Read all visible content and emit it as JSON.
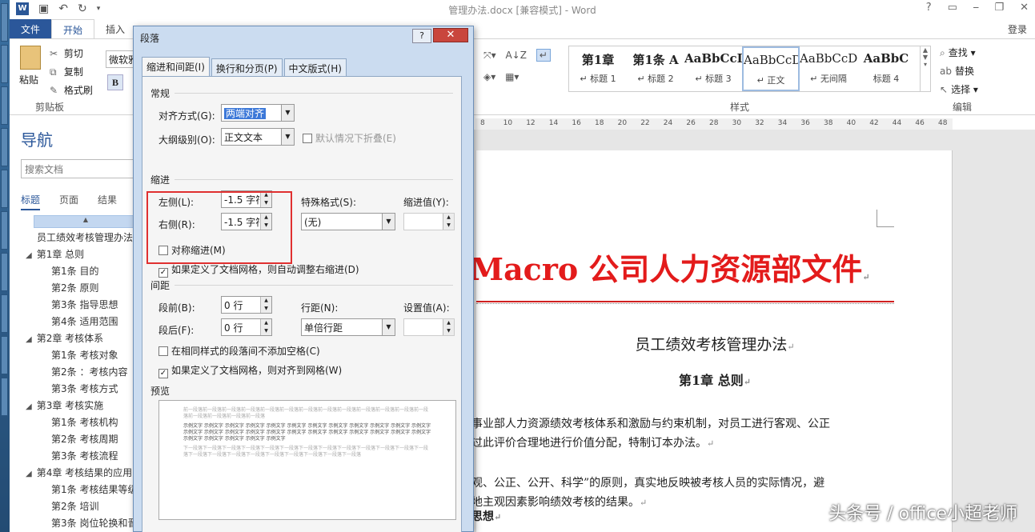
{
  "window": {
    "title": "管理办法.docx [兼容模式] - Word",
    "ctrl_help": "?",
    "ctrl_min": "⎯",
    "ctrl_restore": "❐",
    "ctrl_close": "✕"
  },
  "qat": {
    "app_icon": "W"
  },
  "ribbon": {
    "tabs": [
      "文件",
      "开始",
      "插入"
    ],
    "login": "登录",
    "clipboard": {
      "paste": "粘贴",
      "cut": "剪切",
      "copy": "复制",
      "format_painter": "格式刷",
      "group": "剪贴板"
    },
    "font_name": "微软雅",
    "bold": "B",
    "styles_group": "样式",
    "editing_group": "编辑",
    "styles": [
      {
        "sample": "第1章",
        "name": "↵ 标题 1"
      },
      {
        "sample": "第1条 A",
        "name": "↵ 标题 2"
      },
      {
        "sample": "AaBbCcI",
        "name": "↵ 标题 3"
      },
      {
        "sample": "AaBbCcDd",
        "name": "↵ 正文"
      },
      {
        "sample": "AaBbCcDd",
        "name": "↵ 无间隔"
      },
      {
        "sample": "AaBbC",
        "name": "标题 4"
      }
    ],
    "editing": {
      "find": "查找",
      "replace": "替换",
      "select": "选择"
    }
  },
  "nav": {
    "title": "导航",
    "search_placeholder": "搜索文档",
    "tabs": [
      "标题",
      "页面",
      "结果"
    ],
    "items": [
      {
        "level": 0,
        "text": "员工绩效考核管理办法"
      },
      {
        "level": 1,
        "text": "第1章 总则"
      },
      {
        "level": 2,
        "text": "第1条 目的"
      },
      {
        "level": 2,
        "text": "第2条 原则"
      },
      {
        "level": 2,
        "text": "第3条 指导思想"
      },
      {
        "level": 2,
        "text": "第4条 适用范围"
      },
      {
        "level": 1,
        "text": "第2章 考核体系"
      },
      {
        "level": 2,
        "text": "第1条 考核对象"
      },
      {
        "level": 2,
        "text": "第2条 ：考核内容"
      },
      {
        "level": 2,
        "text": "第3条 考核方式"
      },
      {
        "level": 1,
        "text": "第3章 考核实施"
      },
      {
        "level": 2,
        "text": "第1条 考核机构"
      },
      {
        "level": 2,
        "text": "第2条 考核周期"
      },
      {
        "level": 2,
        "text": "第3条 考核流程"
      },
      {
        "level": 1,
        "text": "第4章 考核结果的应用"
      },
      {
        "level": 2,
        "text": "第1条 考核结果等级"
      },
      {
        "level": 2,
        "text": "第2条 培训"
      },
      {
        "level": 2,
        "text": "第3条 岗位轮换和晋"
      }
    ]
  },
  "ruler": [
    "8",
    "10",
    "12",
    "14",
    "16",
    "18",
    "20",
    "22",
    "24",
    "26",
    "28",
    "30",
    "32",
    "34",
    "36",
    "38",
    "40",
    "42",
    "44",
    "46",
    "48"
  ],
  "document": {
    "red_title": "Macro 公司人力资源部文件",
    "title": "员工绩效考核管理办法",
    "chapter": "第1章  总则",
    "para1_line1": "事业部人力资源绩效考核体系和激励与约束机制，对员工进行客观、公正",
    "para1_line2": "过此评价合理地进行价值分配，特制订本办法。",
    "para2_line1": "观、公正、公开、科学”的原则，真实地反映被考核人员的实际情况，避",
    "para2_line2": "地主观因素影响绩效考核的结果。",
    "para3": "思想"
  },
  "dialog": {
    "title": "段落",
    "help": "?",
    "close": "✕",
    "tabs": [
      "缩进和间距(I)",
      "换行和分页(P)",
      "中文版式(H)"
    ],
    "general": {
      "section": "常规",
      "alignment_label": "对齐方式(G):",
      "alignment_value": "两端对齐",
      "outline_label": "大纲级别(O):",
      "outline_value": "正文文本",
      "collapse_label": "默认情况下折叠(E)"
    },
    "indent": {
      "section": "缩进",
      "left_label": "左侧(L):",
      "left_value": "-1.5 字符",
      "right_label": "右侧(R):",
      "right_value": "-1.5 字符",
      "special_label": "特殊格式(S):",
      "special_value": "(无)",
      "by_label": "缩进值(Y):",
      "mirror_label": "对称缩进(M)",
      "auto_adjust_label": "如果定义了文档网格，则自动调整右缩进(D)"
    },
    "spacing": {
      "section": "间距",
      "before_label": "段前(B):",
      "before_value": "0 行",
      "after_label": "段后(F):",
      "after_value": "0 行",
      "line_label": "行距(N):",
      "line_value": "单倍行距",
      "at_label": "设置值(A):",
      "no_space_label": "在相同样式的段落间不添加空格(C)",
      "snap_grid_label": "如果定义了文档网格，则对齐到网格(W)"
    },
    "preview": {
      "section": "预览",
      "prev_text": "前一段落前一段落前一段落前一段落前一段落前一段落前一段落前一段落前一段落前一段落前一段落前一段落前一段落前一段落前一段落前一段落前一段落",
      "sample_text": "示例文字 示例文字 示例文字 示例文字 示例文字 示例文字 示例文字 示例文字 示例文字 示例文字 示例文字 示例文字 示例文字 示例文字 示例文字 示例文字 示例文字 示例文字 示例文字 示例文字 示例文字 示例文字 示例文字 示例文字 示例文字 示例文字 示例文字 示例文字 示例文字",
      "next_text": "下一段落下一段落下一段落下一段落下一段落下一段落下一段落下一段落下一段落下一段落下一段落下一段落下一段落下一段落下一段落下一段落下一段落下一段落下一段落下一段落下一段落下一段落"
    }
  },
  "watermark": "头条号 / office小超老师",
  "colors": {
    "word_blue": "#2b579a",
    "red_title": "#e31b1b",
    "highlight_box": "#e03030"
  }
}
